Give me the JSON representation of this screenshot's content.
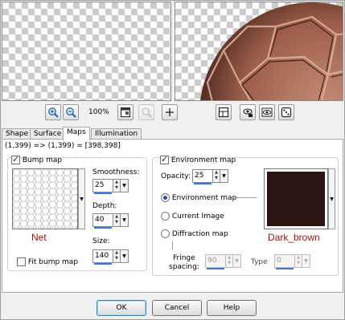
{
  "toolbar": {
    "zoom_level": "100%"
  },
  "tabs": [
    {
      "label": "Shape",
      "active": false
    },
    {
      "label": "Surface",
      "active": false
    },
    {
      "label": "Maps",
      "active": true
    },
    {
      "label": "Illumination",
      "active": false
    }
  ],
  "coords_text": "(1,399) => (1,399) = [398,398]",
  "bump": {
    "title": "Bump map",
    "checked": true,
    "map_name": "Net",
    "smoothness_label": "Smoothness:",
    "smoothness_value": "25",
    "depth_label": "Depth:",
    "depth_value": "40",
    "size_label": "Size:",
    "size_value": "140",
    "fit_label": "Fit bump map",
    "fit_checked": false
  },
  "env": {
    "title": "Environment map",
    "checked": true,
    "opacity_label": "Opacity:",
    "opacity_value": "25",
    "options": [
      {
        "label": "Environment map",
        "selected": true
      },
      {
        "label": "Current Image",
        "selected": false
      },
      {
        "label": "Diffraction map",
        "selected": false
      }
    ],
    "fringe_label_1": "Fringe",
    "fringe_label_2": "spacing:",
    "fringe_value": "90",
    "type_label": "Type",
    "type_value": "0",
    "material_name": "Dark_brown",
    "material_color": "#2e1414"
  },
  "buttons": {
    "ok": "OK",
    "cancel": "Cancel",
    "help": "Help"
  },
  "colors": {
    "accent": "#3a78d8",
    "caption": "#a01414",
    "ball": "#8a5040"
  }
}
